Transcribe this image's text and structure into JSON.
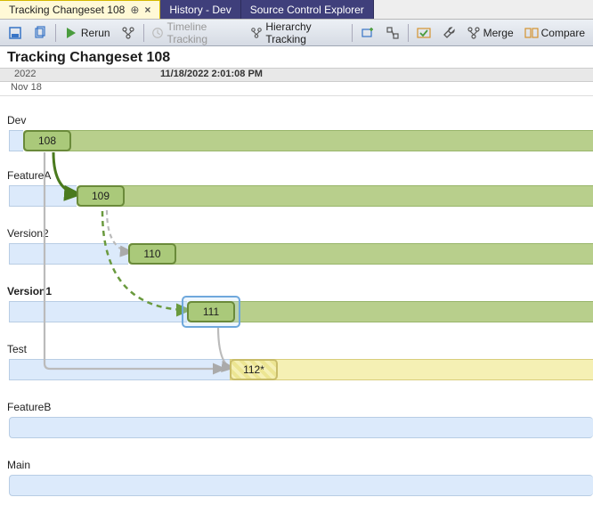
{
  "tabs": {
    "active": "Tracking Changeset 108",
    "t1": "History - Dev",
    "t2": "Source Control Explorer"
  },
  "toolbar": {
    "rerun": "Rerun",
    "timeline": "Timeline Tracking",
    "hierarchy": "Hierarchy Tracking",
    "merge": "Merge",
    "compare": "Compare"
  },
  "title": "Tracking Changeset 108",
  "header": {
    "year": "2022",
    "date": "11/18/2022 2:01:08 PM",
    "sub": "Nov 18"
  },
  "branches": {
    "dev": "Dev",
    "featureA": "FeatureA",
    "version2": "Version2",
    "version1": "Version1",
    "test": "Test",
    "featureB": "FeatureB",
    "main": "Main"
  },
  "changesets": {
    "c108": "108",
    "c109": "109",
    "c110": "110",
    "c111": "111",
    "c112": "112*"
  }
}
